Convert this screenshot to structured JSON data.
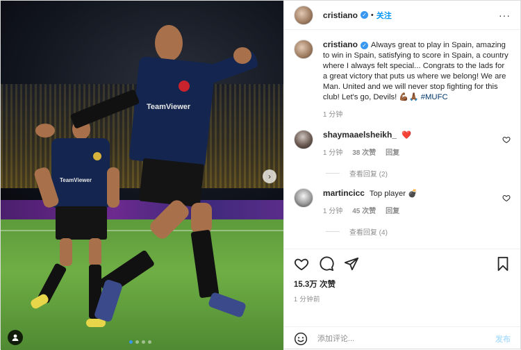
{
  "post": {
    "author": "cristiano",
    "follow_label": "关注",
    "more_label": "···",
    "caption": "Always great to play in Spain, amazing to win in Spain, satisfying to score in Spain, a country where I always felt special... Congrats to the lads for a great victory that puts us where we belong! We are Man. United and we will never stop fighting for this club! Let's go, Devils! 💪🏾🙏🏾",
    "hashtag": "#MUFC",
    "caption_time": "1 分钟",
    "likes": "15.3万 次赞",
    "posted_ago": "1 分钟前"
  },
  "photo": {
    "sponsor_text": "TeamViewer",
    "next_icon": "chevron-right-icon",
    "tag_icon": "user-tag-icon",
    "dots_total": 4,
    "dots_active": 0
  },
  "comments": [
    {
      "user": "shaymaaelsheikh_",
      "text": "❤️",
      "time": "1 分钟",
      "likes": "38 次赞",
      "reply_label": "回复",
      "view_replies": "查看回复 (2)"
    },
    {
      "user": "martincicc",
      "text": "Top player 💣",
      "time": "1 分钟",
      "likes": "45 次赞",
      "reply_label": "回复",
      "view_replies": "查看回复 (4)"
    }
  ],
  "composer": {
    "placeholder": "添加评论...",
    "post_label": "发布"
  },
  "colors": {
    "accent": "#0095f6",
    "verified": "#3897f0",
    "muted": "#8e8e8e",
    "kit": "#14264f"
  }
}
